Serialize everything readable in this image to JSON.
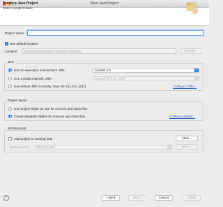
{
  "window": {
    "title": "New Java Project"
  },
  "header": {
    "title": "Create a Java Project",
    "subtitle": "Enter a project name."
  },
  "project_name": {
    "label": "Project name:",
    "value": ""
  },
  "location": {
    "use_default_label": "Use default location",
    "use_default_checked": true,
    "label": "Location:",
    "value": "/Users/yuanzheng/Documents/workspace",
    "browse_label": "Browse..."
  },
  "jre": {
    "group_label": "JRE",
    "option_env_label": "Use an execution environment JRE:",
    "option_env_value": "JavaSE-1.8",
    "option_specific_label": "Use a project specific JRE:",
    "option_specific_value": "Java SE 8 [1.8.0_101]",
    "option_default_label": "Use default JRE (currently 'Java SE 8 [1.8.0_101]')",
    "configure_label": "Configure JREs..."
  },
  "project_layout": {
    "group_label": "Project layout",
    "option_root_label": "Use project folder as root for sources and class files",
    "option_separate_label": "Create separate folders for sources and class files",
    "configure_label": "Configure default..."
  },
  "working_sets": {
    "group_label": "Working sets",
    "add_label": "Add project to working sets",
    "new_label": "New...",
    "sets_label": "Working sets:",
    "sets_value": "1RBUJJavaSE",
    "select_label": "Select..."
  },
  "footer": {
    "help_glyph": "?",
    "back_label": "< Back",
    "next_label": "Next >",
    "cancel_label": "Cancel",
    "finish_label": "Finish"
  },
  "colors": {
    "accent": "#2f7bf5",
    "link": "#2463c7",
    "window_bg": "#ececec"
  }
}
